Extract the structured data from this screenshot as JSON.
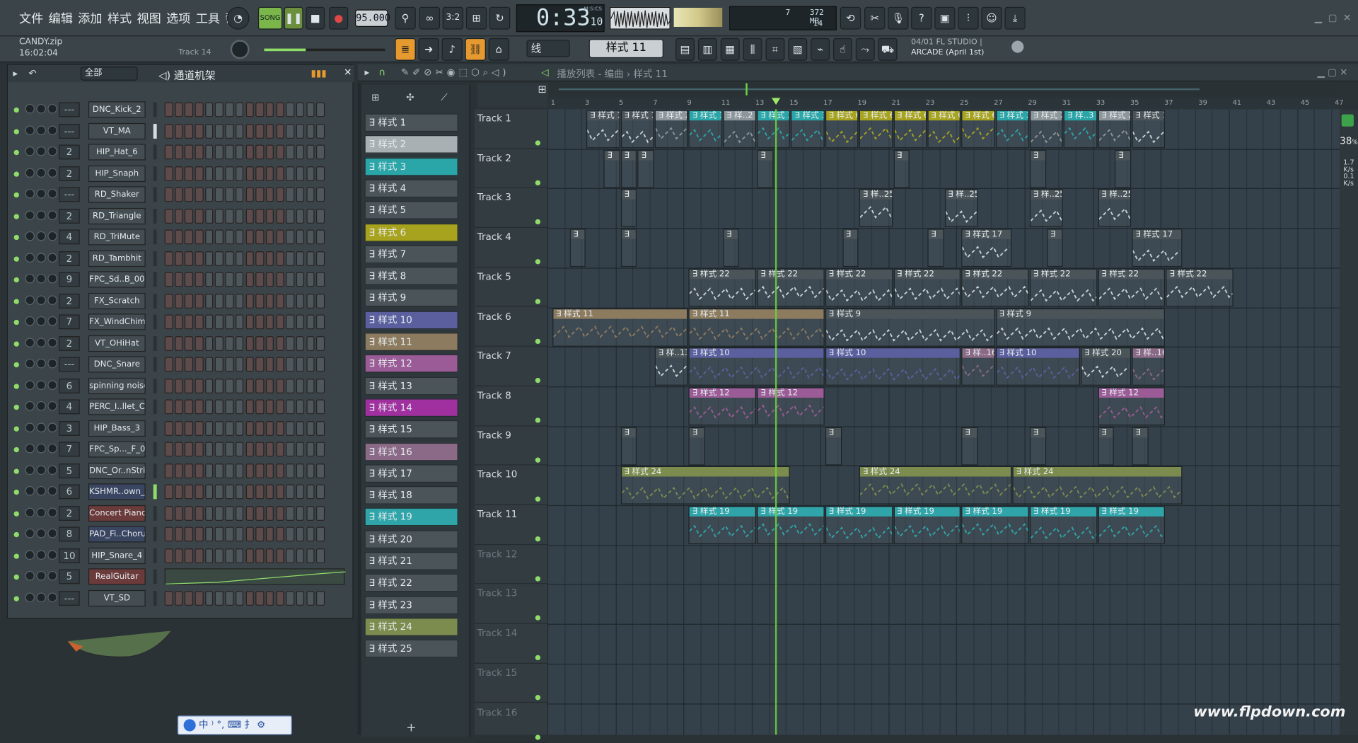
{
  "menu": [
    "文件",
    "编辑",
    "添加",
    "样式",
    "视图",
    "选项",
    "工具",
    "帮助"
  ],
  "transport": {
    "mode": "SONG",
    "tempo": "95.000",
    "time": "0:33",
    "time_sub": "10",
    "time_unit": "M:S:CS",
    "mem": "372 MB",
    "cpu": "7",
    "poly": "14"
  },
  "project": {
    "name": "CANDY.zip",
    "clock": "16:02:04",
    "hint": "Track 14"
  },
  "snap": "线",
  "pattern_selector": "样式 11",
  "news": {
    "date": "04/01",
    "line1": "FL STUDIO |",
    "line2": "ARCADE (April 1st)"
  },
  "rack": {
    "title": "通道机架",
    "filter": "全部",
    "channels": [
      {
        "num": "---",
        "name": "DNC_Kick_2"
      },
      {
        "num": "---",
        "name": "VT_MA"
      },
      {
        "num": "2",
        "name": "HIP_Hat_6"
      },
      {
        "num": "2",
        "name": "HIP_Snaph"
      },
      {
        "num": "---",
        "name": "RD_Shaker"
      },
      {
        "num": "2",
        "name": "RD_Triangle"
      },
      {
        "num": "4",
        "name": "RD_TriMute"
      },
      {
        "num": "2",
        "name": "RD_Tambhit"
      },
      {
        "num": "9",
        "name": "FPC_Sd..B_004"
      },
      {
        "num": "2",
        "name": "FX_Scratch"
      },
      {
        "num": "7",
        "name": "FX_WindChimes"
      },
      {
        "num": "2",
        "name": "VT_OHiHat"
      },
      {
        "num": "---",
        "name": "DNC_Snare"
      },
      {
        "num": "6",
        "name": "spinning noise"
      },
      {
        "num": "4",
        "name": "PERC_I..llet_C4"
      },
      {
        "num": "3",
        "name": "HIP_Bass_3"
      },
      {
        "num": "7",
        "name": "FPC_Sp..._F_006"
      },
      {
        "num": "5",
        "name": "DNC_Or..nString"
      },
      {
        "num": "6",
        "name": "KSHMR..own_E"
      },
      {
        "num": "2",
        "name": "Concert Piano"
      },
      {
        "num": "8",
        "name": "PAD_Fi..Chorus"
      },
      {
        "num": "10",
        "name": "HIP_Snare_4"
      },
      {
        "num": "5",
        "name": "RealGuitar"
      },
      {
        "num": "---",
        "name": "VT_SD"
      }
    ]
  },
  "patterns": [
    "样式 1",
    "样式 2",
    "样式 3",
    "样式 4",
    "样式 5",
    "样式 6",
    "样式 7",
    "样式 8",
    "样式 9",
    "样式 10",
    "样式 11",
    "样式 12",
    "样式 13",
    "样式 14",
    "样式 15",
    "样式 16",
    "样式 17",
    "样式 18",
    "样式 19",
    "样式 20",
    "样式 21",
    "样式 22",
    "样式 23",
    "样式 24",
    "样式 25"
  ],
  "pattern_colors": [
    "#4a5459",
    "#a9b0b3",
    "#2aa6a8",
    "#4a5459",
    "#4a5459",
    "#a8a31f",
    "#4a5459",
    "#4a5459",
    "#4a5459",
    "#5b5f9e",
    "#8d7b60",
    "#9a5b96",
    "#4a5459",
    "#a0309f",
    "#4a5459",
    "#8a6a86",
    "#4a5459",
    "#4a5459",
    "#2fa5aa",
    "#4a5459",
    "#4a5459",
    "#4a5459",
    "#4a5459",
    "#7c8c4e",
    "#4a5459"
  ],
  "playlist": {
    "title": "播放列表 - 编曲 › 样式 11",
    "tracks": [
      "Track 1",
      "Track 2",
      "Track 3",
      "Track 4",
      "Track 5",
      "Track 6",
      "Track 7",
      "Track 8",
      "Track 9",
      "Track 10",
      "Track 11",
      "Track 12",
      "Track 13",
      "Track 14",
      "Track 15",
      "Track 16"
    ],
    "ruler": [
      "1",
      "3",
      "5",
      "7",
      "9",
      "11",
      "13",
      "15",
      "17",
      "19",
      "21",
      "23",
      "25",
      "27",
      "29",
      "31",
      "33",
      "35",
      "37",
      "39",
      "41",
      "43",
      "45",
      "47"
    ],
    "cpu_pct": "38",
    "cpu_unit": "%",
    "in_rate": "1.7",
    "out_rate": "0.1",
    "rate_unit": "K/s"
  },
  "clips": [
    {
      "t": 0,
      "bar": 3,
      "len": 2,
      "label": "样式 1",
      "color": "#4a5459"
    },
    {
      "t": 0,
      "bar": 5,
      "len": 2,
      "label": "样式 1",
      "color": "#4a5459"
    },
    {
      "t": 0,
      "bar": 7,
      "len": 2,
      "label": "样式 2",
      "color": "#8d969a"
    },
    {
      "t": 0,
      "bar": 9,
      "len": 2,
      "label": "样式 3",
      "color": "#2aa6a8"
    },
    {
      "t": 0,
      "bar": 11,
      "len": 2,
      "label": "样..2",
      "color": "#8d969a"
    },
    {
      "t": 0,
      "bar": 13,
      "len": 2,
      "label": "样式 3",
      "color": "#2aa6a8"
    },
    {
      "t": 0,
      "bar": 15,
      "len": 2,
      "label": "样式 3",
      "color": "#2aa6a8"
    },
    {
      "t": 0,
      "bar": 17,
      "len": 2,
      "label": "样式 6",
      "color": "#a8a31f"
    },
    {
      "t": 0,
      "bar": 19,
      "len": 2,
      "label": "样式 6",
      "color": "#a8a31f"
    },
    {
      "t": 0,
      "bar": 21,
      "len": 2,
      "label": "样式 6",
      "color": "#a8a31f"
    },
    {
      "t": 0,
      "bar": 23,
      "len": 2,
      "label": "样式 6",
      "color": "#a8a31f"
    },
    {
      "t": 0,
      "bar": 25,
      "len": 2,
      "label": "样式 6",
      "color": "#a8a31f"
    },
    {
      "t": 0,
      "bar": 27,
      "len": 2,
      "label": "样式 3",
      "color": "#2aa6a8"
    },
    {
      "t": 0,
      "bar": 29,
      "len": 2,
      "label": "样式 2",
      "color": "#8d969a"
    },
    {
      "t": 0,
      "bar": 31,
      "len": 2,
      "label": "样..3",
      "color": "#2aa6a8"
    },
    {
      "t": 0,
      "bar": 33,
      "len": 2,
      "label": "样式 2",
      "color": "#8d969a"
    },
    {
      "t": 0,
      "bar": 35,
      "len": 2,
      "label": "样式 1",
      "color": "#4a5459"
    },
    {
      "t": 4,
      "bar": 9,
      "len": 4,
      "label": "样式 22",
      "color": "#4a5459"
    },
    {
      "t": 4,
      "bar": 13,
      "len": 4,
      "label": "样式 22",
      "color": "#4a5459"
    },
    {
      "t": 4,
      "bar": 17,
      "len": 4,
      "label": "样式 22",
      "color": "#4a5459"
    },
    {
      "t": 4,
      "bar": 21,
      "len": 4,
      "label": "样式 22",
      "color": "#4a5459"
    },
    {
      "t": 4,
      "bar": 25,
      "len": 4,
      "label": "样式 22",
      "color": "#4a5459"
    },
    {
      "t": 4,
      "bar": 29,
      "len": 4,
      "label": "样式 22",
      "color": "#4a5459"
    },
    {
      "t": 4,
      "bar": 33,
      "len": 4,
      "label": "样式 22",
      "color": "#4a5459"
    },
    {
      "t": 4,
      "bar": 37,
      "len": 4,
      "label": "样式 22",
      "color": "#4a5459"
    },
    {
      "t": 5,
      "bar": 1,
      "len": 8,
      "label": "样式 11",
      "color": "#8d7b60"
    },
    {
      "t": 5,
      "bar": 9,
      "len": 8,
      "label": "样式 11",
      "color": "#8d7b60"
    },
    {
      "t": 5,
      "bar": 17,
      "len": 10,
      "label": "样式 9",
      "color": "#4a5459"
    },
    {
      "t": 5,
      "bar": 27,
      "len": 10,
      "label": "样式 9",
      "color": "#4a5459"
    },
    {
      "t": 6,
      "bar": 7,
      "len": 2,
      "label": "样..13",
      "color": "#4a5459"
    },
    {
      "t": 6,
      "bar": 9,
      "len": 8,
      "label": "样式 10",
      "color": "#5b5f9e"
    },
    {
      "t": 6,
      "bar": 17,
      "len": 8,
      "label": "样式 10",
      "color": "#5b5f9e"
    },
    {
      "t": 6,
      "bar": 25,
      "len": 2,
      "label": "样..16",
      "color": "#8a6a86"
    },
    {
      "t": 6,
      "bar": 27,
      "len": 5,
      "label": "样式 10",
      "color": "#5b5f9e"
    },
    {
      "t": 6,
      "bar": 32,
      "len": 3,
      "label": "样式 20",
      "color": "#4a5459"
    },
    {
      "t": 6,
      "bar": 35,
      "len": 2,
      "label": "样..16",
      "color": "#8a6a86"
    },
    {
      "t": 7,
      "bar": 9,
      "len": 4,
      "label": "样式 12",
      "color": "#9a5b96"
    },
    {
      "t": 7,
      "bar": 13,
      "len": 4,
      "label": "样式 12",
      "color": "#9a5b96"
    },
    {
      "t": 7,
      "bar": 33,
      "len": 4,
      "label": "样式 12",
      "color": "#9a5b96"
    },
    {
      "t": 9,
      "bar": 5,
      "len": 10,
      "label": "样式 24",
      "color": "#7c8c4e"
    },
    {
      "t": 9,
      "bar": 19,
      "len": 9,
      "label": "样式 24",
      "color": "#7c8c4e"
    },
    {
      "t": 9,
      "bar": 28,
      "len": 10,
      "label": "样式 24",
      "color": "#7c8c4e"
    },
    {
      "t": 10,
      "bar": 9,
      "len": 4,
      "label": "样式 19",
      "color": "#2fa5aa"
    },
    {
      "t": 10,
      "bar": 13,
      "len": 4,
      "label": "样式 19",
      "color": "#2fa5aa"
    },
    {
      "t": 10,
      "bar": 17,
      "len": 4,
      "label": "样式 19",
      "color": "#2fa5aa"
    },
    {
      "t": 10,
      "bar": 21,
      "len": 4,
      "label": "样式 19",
      "color": "#2fa5aa"
    },
    {
      "t": 10,
      "bar": 25,
      "len": 4,
      "label": "样式 19",
      "color": "#2fa5aa"
    },
    {
      "t": 10,
      "bar": 29,
      "len": 4,
      "label": "样式 19",
      "color": "#2fa5aa"
    },
    {
      "t": 10,
      "bar": 33,
      "len": 4,
      "label": "样式 19",
      "color": "#2fa5aa"
    },
    {
      "t": 2,
      "bar": 19,
      "len": 2,
      "label": "样..25",
      "color": "#4a5459"
    },
    {
      "t": 2,
      "bar": 24,
      "len": 2,
      "label": "样..25",
      "color": "#4a5459"
    },
    {
      "t": 2,
      "bar": 29,
      "len": 2,
      "label": "样..25",
      "color": "#4a5459"
    },
    {
      "t": 2,
      "bar": 33,
      "len": 2,
      "label": "样..25",
      "color": "#4a5459"
    },
    {
      "t": 3,
      "bar": 25,
      "len": 3,
      "label": "样式 17",
      "color": "#4a5459"
    },
    {
      "t": 3,
      "bar": 35,
      "len": 3,
      "label": "样式 17",
      "color": "#4a5459"
    }
  ],
  "smallclips": [
    [
      1,
      4
    ],
    [
      1,
      5
    ],
    [
      1,
      6
    ],
    [
      1,
      13
    ],
    [
      1,
      21
    ],
    [
      1,
      29
    ],
    [
      1,
      34
    ],
    [
      2,
      5
    ],
    [
      3,
      2
    ],
    [
      3,
      5
    ],
    [
      3,
      11
    ],
    [
      3,
      18
    ],
    [
      3,
      23
    ],
    [
      3,
      30
    ],
    [
      8,
      5
    ],
    [
      8,
      9
    ],
    [
      8,
      17
    ],
    [
      8,
      25
    ],
    [
      8,
      29
    ],
    [
      8,
      33
    ],
    [
      8,
      35
    ]
  ],
  "ime": "中 ⁾ °, ⌨ ⺘ ⚙",
  "watermark": "www.flpdown.com",
  "colors": {
    "accent_green": "#8fdc6b",
    "playhead": "#6bd63c"
  }
}
